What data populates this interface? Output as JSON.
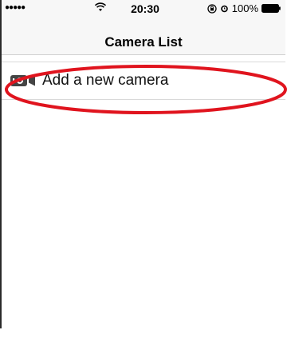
{
  "status_bar": {
    "signal_dots": "●●●●●",
    "time": "20:30",
    "battery_percent": "100%",
    "icons": [
      "wifi-icon",
      "rotation-lock-icon",
      "alarm-icon",
      "battery-icon"
    ]
  },
  "nav": {
    "title": "Camera List"
  },
  "list": {
    "items": [
      {
        "label": "Add a new camera",
        "icon": "video-camera-icon"
      }
    ]
  },
  "annotation": {
    "highlight_color": "#e0141e",
    "shape": "ellipse"
  },
  "colors": {
    "bar_background": "#f7f7f7",
    "separator": "#d9d9d9",
    "icon": "#444444"
  }
}
